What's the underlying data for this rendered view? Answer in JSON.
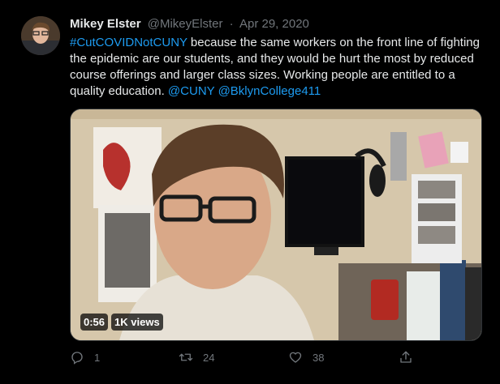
{
  "tweet": {
    "author_name": "Mikey Elster",
    "author_handle": "@MikeyElster",
    "separator": "·",
    "date": "Apr 29, 2020",
    "hashtag": "#CutCOVIDNotCUNY",
    "text": " because the same workers on the front line of fighting the epidemic are our students, and they would be hurt the most by reduced course offerings and larger class sizes. Working people are entitled to a quality education. ",
    "mention_1": "@CUNY",
    "mention_2": "@BklynCollege411"
  },
  "video": {
    "duration": "0:56",
    "views": "1K views"
  },
  "actions": {
    "reply_count": "1",
    "retweet_count": "24",
    "like_count": "38",
    "share_icon": "share-icon",
    "reply_icon": "reply-icon",
    "retweet_icon": "retweet-icon",
    "like_icon": "heart-icon"
  },
  "colors": {
    "background": "#000000",
    "link": "#1d9bf0",
    "secondary_text": "#71767b",
    "primary_text": "#e7e9ea"
  }
}
